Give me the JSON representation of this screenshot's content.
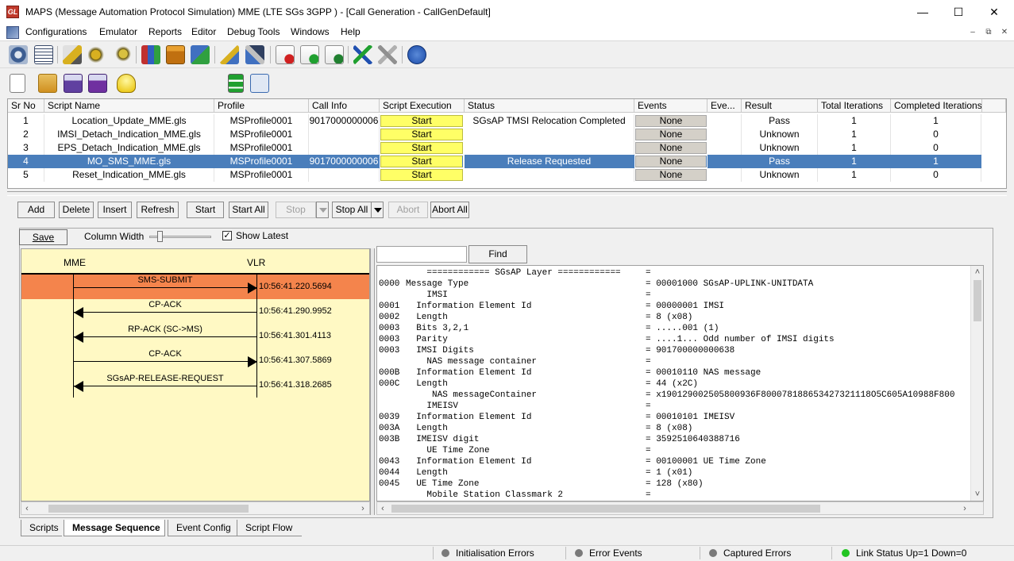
{
  "window": {
    "title": "MAPS (Message Automation Protocol Simulation) MME (LTE SGs 3GPP ) - [Call Generation  - CallGenDefault]",
    "minimize": "—",
    "maximize": "☐",
    "close": "✕"
  },
  "menu": {
    "items": [
      "Configurations",
      "Emulator",
      "Reports",
      "Editor",
      "Debug Tools",
      "Windows",
      "Help"
    ],
    "mdi_min": "–",
    "mdi_restore": "⧉",
    "mdi_close": "✕"
  },
  "grid": {
    "headers": [
      "Sr No",
      "Script Name",
      "Profile",
      "Call Info",
      "Script Execution",
      "Status",
      "Events",
      "Eve...",
      "Result",
      "Total Iterations",
      "Completed Iterations"
    ],
    "rows": [
      {
        "sr": "1",
        "script": "Location_Update_MME.gls",
        "profile": "MSProfile0001",
        "call_info": "9017000000006",
        "exec": "Start",
        "status": "SGsAP TMSI Relocation Completed",
        "events": "None",
        "eve": "",
        "result": "Pass",
        "total": "1",
        "completed": "1"
      },
      {
        "sr": "2",
        "script": "IMSI_Detach_Indication_MME.gls",
        "profile": "MSProfile0001",
        "call_info": "",
        "exec": "Start",
        "status": "",
        "events": "None",
        "eve": "",
        "result": "Unknown",
        "total": "1",
        "completed": "0"
      },
      {
        "sr": "3",
        "script": "EPS_Detach_Indication_MME.gls",
        "profile": "MSProfile0001",
        "call_info": "",
        "exec": "Start",
        "status": "",
        "events": "None",
        "eve": "",
        "result": "Unknown",
        "total": "1",
        "completed": "0"
      },
      {
        "sr": "4",
        "script": "MO_SMS_MME.gls",
        "profile": "MSProfile0001",
        "call_info": "9017000000006",
        "exec": "Start",
        "status": "Release Requested",
        "events": "None",
        "eve": "",
        "result": "Pass",
        "total": "1",
        "completed": "1"
      },
      {
        "sr": "5",
        "script": "Reset_Indication_MME.gls",
        "profile": "MSProfile0001",
        "call_info": "",
        "exec": "Start",
        "status": "",
        "events": "None",
        "eve": "",
        "result": "Unknown",
        "total": "1",
        "completed": "0"
      }
    ],
    "selected_row": 4
  },
  "actions": {
    "add": "Add",
    "delete": "Delete",
    "insert": "Insert",
    "refresh": "Refresh",
    "start": "Start",
    "start_all": "Start All",
    "stop": "Stop",
    "stop_all": "Stop All",
    "abort": "Abort",
    "abort_all": "Abort All"
  },
  "panel": {
    "save": "Save",
    "column_width": "Column Width",
    "show_latest": "Show Latest",
    "show_latest_checked": "✓",
    "find": "Find",
    "find_value": ""
  },
  "sequence": {
    "nodes": [
      "MME",
      "VLR"
    ],
    "messages": [
      {
        "label": "SMS-SUBMIT",
        "direction": "right",
        "timestamp": "10:56:41.220.5694",
        "highlighted": true
      },
      {
        "label": "CP-ACK",
        "direction": "left",
        "timestamp": "10:56:41.290.9952",
        "highlighted": false
      },
      {
        "label": "RP-ACK (SC->MS)",
        "direction": "left",
        "timestamp": "10:56:41.301.4113",
        "highlighted": false
      },
      {
        "label": "CP-ACK",
        "direction": "right",
        "timestamp": "10:56:41.307.5869",
        "highlighted": false
      },
      {
        "label": "SGsAP-RELEASE-REQUEST",
        "direction": "left",
        "timestamp": "10:56:41.318.2685",
        "highlighted": false
      }
    ],
    "highlight_color": "#f4844c"
  },
  "decode": [
    {
      "offset": "",
      "field": "    ============ SGsAP Layer ============",
      "value": "="
    },
    {
      "offset": "0000",
      "field": "Message Type",
      "value": "= 00001000 SGsAP-UPLINK-UNITDATA"
    },
    {
      "offset": "",
      "field": "    IMSI",
      "value": "="
    },
    {
      "offset": "0001",
      "field": "  Information Element Id",
      "value": "= 00000001 IMSI"
    },
    {
      "offset": "0002",
      "field": "  Length",
      "value": "= 8 (x08)"
    },
    {
      "offset": "0003",
      "field": "  Bits 3,2,1",
      "value": "= .....001 (1)"
    },
    {
      "offset": "0003",
      "field": "  Parity",
      "value": "= ....1... Odd number of IMSI digits"
    },
    {
      "offset": "0003",
      "field": "  IMSI Digits",
      "value": "= 901700000000638"
    },
    {
      "offset": "",
      "field": "    NAS message container",
      "value": "="
    },
    {
      "offset": "000B",
      "field": "  Information Element Id",
      "value": "= 00010110 NAS message"
    },
    {
      "offset": "000C",
      "field": "  Length",
      "value": "= 44 (x2C)"
    },
    {
      "offset": "",
      "field": "     NAS messageContainer",
      "value": "= x19012900250580093​6F800078188653427321118O5C605A10988F800"
    },
    {
      "offset": "",
      "field": "    IMEISV",
      "value": "="
    },
    {
      "offset": "0039",
      "field": "  Information Element Id",
      "value": "= 00010101 IMEISV"
    },
    {
      "offset": "003A",
      "field": "  Length",
      "value": "= 8 (x08)"
    },
    {
      "offset": "003B",
      "field": "  IMEISV digit",
      "value": "= 3592510640388716"
    },
    {
      "offset": "",
      "field": "    UE Time Zone",
      "value": "="
    },
    {
      "offset": "0043",
      "field": "  Information Element Id",
      "value": "= 00100001 UE Time Zone"
    },
    {
      "offset": "0044",
      "field": "  Length",
      "value": "= 1 (x01)"
    },
    {
      "offset": "0045",
      "field": "  UE Time Zone",
      "value": "= 128 (x80)"
    },
    {
      "offset": "",
      "field": "    Mobile Station Classmark 2",
      "value": "="
    }
  ],
  "tabs": [
    {
      "label": "Scripts",
      "active": false
    },
    {
      "label": "Message Sequence",
      "active": true
    },
    {
      "label": "Event Config",
      "active": false
    },
    {
      "label": "Script Flow",
      "active": false
    }
  ],
  "status_bar": [
    {
      "label": "Initialisation Errors",
      "color": "#7a7a7a"
    },
    {
      "label": "Error Events",
      "color": "#7a7a7a"
    },
    {
      "label": "Captured Errors",
      "color": "#7a7a7a"
    },
    {
      "label": "Link Status Up=1 Down=0",
      "color": "#22c422"
    }
  ],
  "icons": {
    "app": "GL",
    "toolbar1": [
      "gear-icon",
      "notebook-icon",
      "profile-edit-icon",
      "gears-icon",
      "gears-small-icon",
      "books-icon",
      "briefcase-icon",
      "network-user-icon",
      "check-edit-icon",
      "tools-icon",
      "doc-d-icon",
      "doc-c-icon",
      "doc-p-icon",
      "link-arrow-icon",
      "disconnect-icon",
      "help-icon"
    ],
    "toolbar2": [
      "new-file-icon",
      "open-folder-icon",
      "save-icon",
      "save-as-icon",
      "lightbulb-icon",
      "vertical-layout-icon",
      "tree-layout-icon"
    ]
  }
}
